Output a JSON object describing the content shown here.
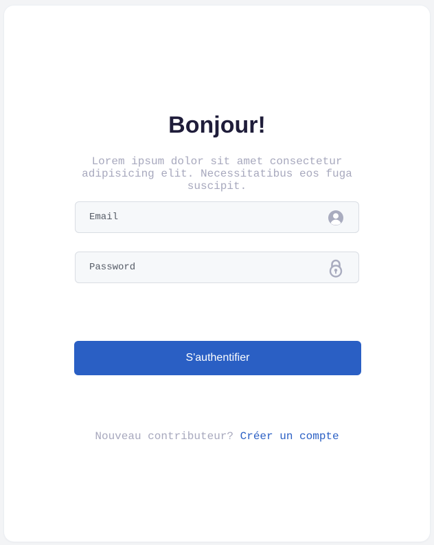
{
  "login": {
    "title": "Bonjour!",
    "subtitle": "Lorem ipsum dolor sit amet consectetur adipisicing elit. Necessitatibus eos fuga suscipit.",
    "email": {
      "placeholder": "Email",
      "value": "",
      "icon": "user-circle-icon"
    },
    "password": {
      "placeholder": "Password",
      "value": "",
      "icon": "lock-icon"
    },
    "submit_label": "S'authentifier",
    "footer": {
      "prompt": "Nouveau contributeur?",
      "link_label": "Créer un compte"
    }
  },
  "colors": {
    "accent": "#2a5fc4",
    "title": "#1f1d3a",
    "muted_text": "#a7a8bd",
    "field_background": "#f6f8fa",
    "icon": "#a9acbf"
  }
}
